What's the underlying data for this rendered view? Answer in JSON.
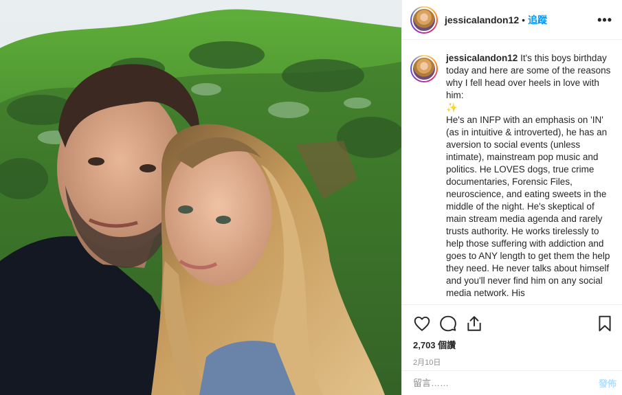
{
  "post": {
    "author": {
      "username": "jessicalandon12",
      "follow_label": "追蹤",
      "separator": "•",
      "more_label": "•••"
    },
    "caption": {
      "username": "jessicalandon12",
      "text": " It's this boys birthday today and here are some of the reasons why I fell head over heels in love with him:\n✨\nHe's an INFP with an emphasis on 'IN' (as in intuitive & introverted), he has an aversion to social events (unless intimate), mainstream pop music and politics. He LOVES dogs, true crime documentaries, Forensic Files, neuroscience, and eating sweets in the middle of the night. He's skeptical of main stream media agenda and rarely trusts authority. He works tirelessly to help those suffering with addiction and goes to ANY length to get them the help they need. He never talks about himself and you'll never find him on any social media network. His"
    },
    "actions": {
      "like_icon": "heart-icon",
      "comment_icon": "comment-icon",
      "share_icon": "share-icon",
      "save_icon": "bookmark-icon"
    },
    "likes_text": "2,703 個讚",
    "date_text": "2月10日",
    "comment_input": {
      "placeholder": "留言……",
      "post_label": "發佈"
    },
    "colors": {
      "accent": "#0095f6",
      "post_disabled": "#b2dffc",
      "muted": "#8e8e8e"
    }
  }
}
